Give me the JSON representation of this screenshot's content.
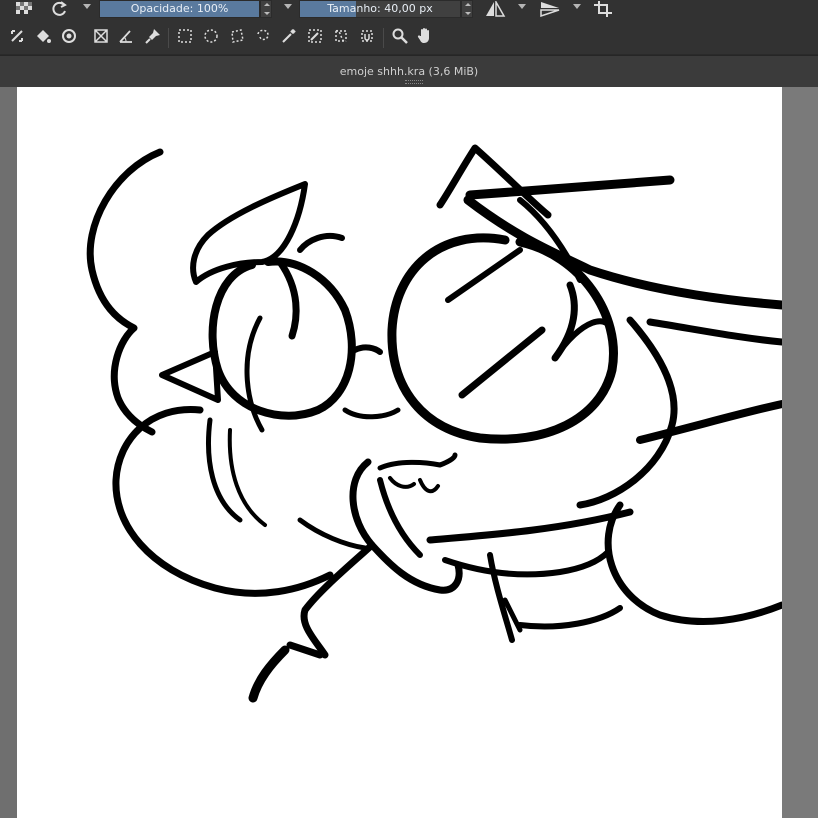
{
  "toolbar": {
    "opacity_label": "Opacidade: 100%",
    "opacity_value": 1.0,
    "size_label": "Tamanho: 40,00 px",
    "size_fill": 0.35
  },
  "document": {
    "title": "emoje shhh.kra (3,6 MiB)"
  },
  "colors": {
    "slider": "#5a7a9e",
    "panel": "#323232",
    "canvas": "#ffffff"
  }
}
